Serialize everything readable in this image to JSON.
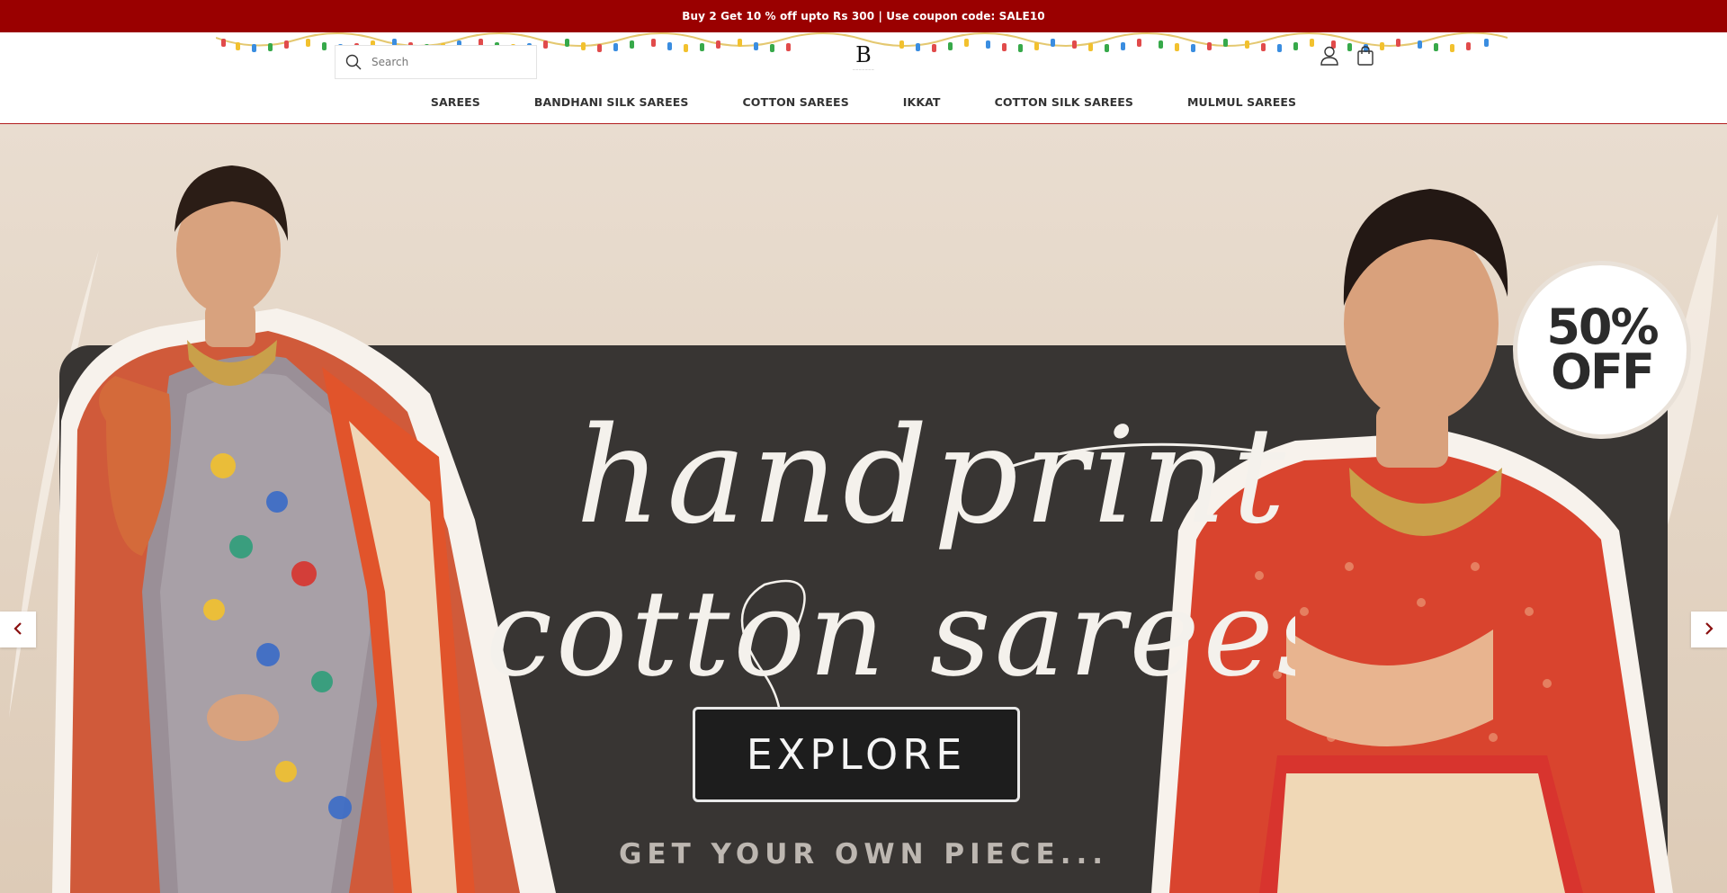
{
  "announcement": {
    "text": "Buy 2 Get 10 % off upto Rs 300 | Use coupon code: SALE10"
  },
  "header": {
    "search_placeholder": "Search",
    "logo_mark": "B",
    "icons": {
      "search": "search-icon",
      "account": "user-icon",
      "cart": "shopping-bag-icon"
    }
  },
  "nav": {
    "items": [
      {
        "label": "SAREES"
      },
      {
        "label": "BANDHANI SILK SAREES"
      },
      {
        "label": "COTTON SAREES"
      },
      {
        "label": "IKKAT"
      },
      {
        "label": "COTTON SILK SAREES"
      },
      {
        "label": "MULMUL SAREES"
      }
    ]
  },
  "hero": {
    "script_line1": "handprint",
    "script_line2": "cotton sarees",
    "badge_line1": "50%",
    "badge_line2": "OFF",
    "cta_label": "EXPLORE",
    "tagline": "GET YOUR OWN PIECE...",
    "icons": {
      "prev": "chevron-left-icon",
      "next": "chevron-right-icon"
    }
  },
  "colors": {
    "announcement_bg": "#9a0000",
    "nav_divider": "#b21e1e",
    "panel": "#383533",
    "hero_bg": "#e3d4c4"
  }
}
